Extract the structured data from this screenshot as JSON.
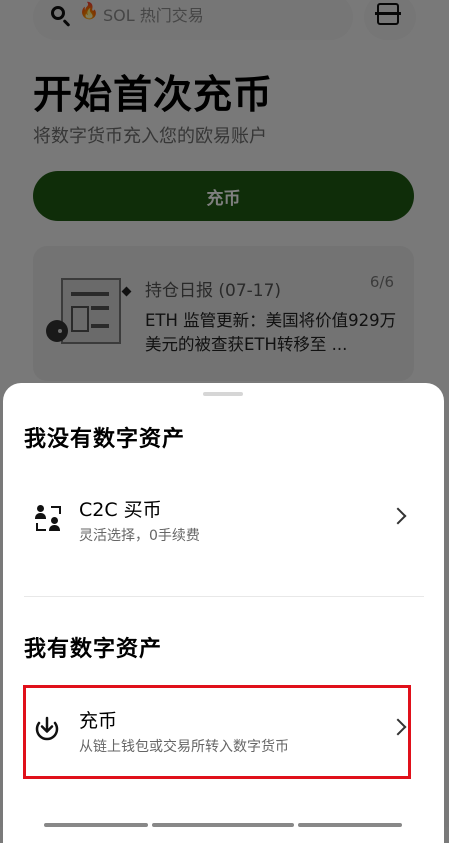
{
  "search": {
    "placeholder_token": "SOL",
    "placeholder_text": "热门交易"
  },
  "hero": {
    "title": "开始首次充币",
    "subtitle": "将数字货币充入您的欧易账户",
    "button_label": "充币"
  },
  "news": {
    "title": "持仓日报 (07-17)",
    "page": "6/6",
    "body": "ETH 监管更新：美国将价值929万美元的被查获ETH转移至 ..."
  },
  "sheet": {
    "section_no_assets": "我没有数字资产",
    "c2c": {
      "title": "C2C 买币",
      "subtitle": "灵活选择，0手续费"
    },
    "section_have_assets": "我有数字资产",
    "deposit": {
      "title": "充币",
      "subtitle": "从链上钱包或交易所转入数字货币"
    }
  },
  "colors": {
    "brand_green": "#1e5a12",
    "highlight_red": "#e0101a",
    "fire_orange": "#ff5a2a"
  },
  "icons": [
    "search-icon",
    "fire-icon",
    "scan-icon",
    "p2p-users-icon",
    "download-icon",
    "chevron-right-icon"
  ]
}
